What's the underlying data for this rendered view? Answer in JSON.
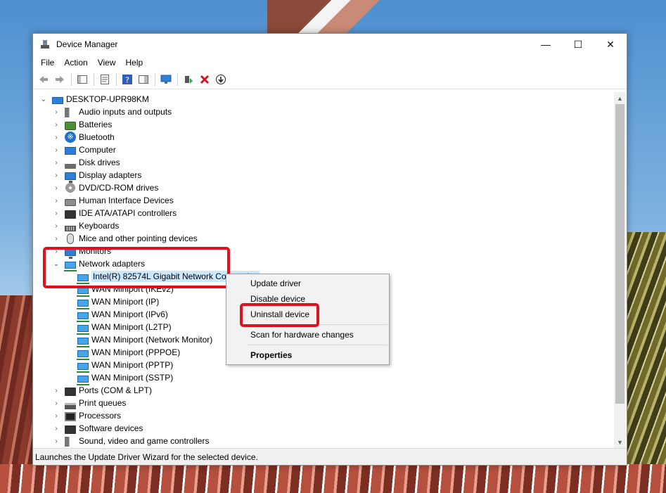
{
  "window": {
    "title": "Device Manager",
    "minimize_glyph": "—",
    "maximize_glyph": "☐",
    "close_glyph": "✕"
  },
  "menu": [
    "File",
    "Action",
    "View",
    "Help"
  ],
  "toolbar": {
    "buttons": [
      "back-arrow-icon",
      "forward-arrow-icon",
      "show-hide-console-tree-icon",
      "properties-icon",
      "help-icon",
      "action-pane-icon",
      "scan-hardware-icon",
      "update-driver-icon",
      "uninstall-device-icon",
      "enable-device-icon"
    ]
  },
  "tree": {
    "root": "DESKTOP-UPR98KM",
    "categories": [
      "Audio inputs and outputs",
      "Batteries",
      "Bluetooth",
      "Computer",
      "Disk drives",
      "Display adapters",
      "DVD/CD-ROM drives",
      "Human Interface Devices",
      "IDE ATA/ATAPI controllers",
      "Keyboards",
      "Mice and other pointing devices",
      "Monitors",
      "Network adapters"
    ],
    "network_adapters": [
      "Intel(R) 82574L Gigabit Network Connection",
      "WAN Miniport (IKEv2)",
      "WAN Miniport (IP)",
      "WAN Miniport (IPv6)",
      "WAN Miniport (L2TP)",
      "WAN Miniport (Network Monitor)",
      "WAN Miniport (PPPOE)",
      "WAN Miniport (PPTP)",
      "WAN Miniport (SSTP)"
    ],
    "categories_after": [
      "Ports (COM & LPT)",
      "Print queues",
      "Processors",
      "Software devices",
      "Sound, video and game controllers"
    ]
  },
  "context_menu": {
    "update_driver": "Update driver",
    "disable_device": "Disable device",
    "uninstall_device": "Uninstall device",
    "scan_hardware": "Scan for hardware changes",
    "properties": "Properties"
  },
  "status_bar": "Launches the Update Driver Wizard for the selected device.",
  "colors": {
    "highlight_box": "#e0101e",
    "selection": "#cce8ff"
  }
}
